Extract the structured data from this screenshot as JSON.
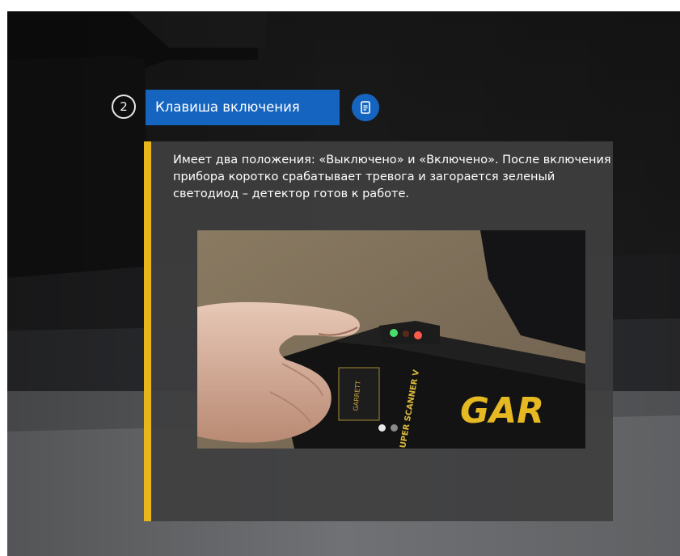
{
  "step": {
    "number": "2",
    "title": "Клавиша включения",
    "info_icon": "document-icon"
  },
  "panel": {
    "description": "Имеет два положения: «Выключено» и «Включено». После включения прибора коротко срабатывает тревога и загорается зеленый светодиод – детектор готов к работе.",
    "accent_color": "#e6b61a",
    "image": {
      "brand_text": "GAR",
      "model_text": "SUPER SCANNER V",
      "maker_text": "GARRETT"
    },
    "carousel": {
      "slides": 2,
      "active": 1
    }
  },
  "colors": {
    "button_blue": "#1565c0",
    "panel_bg": "#3e3e40"
  }
}
